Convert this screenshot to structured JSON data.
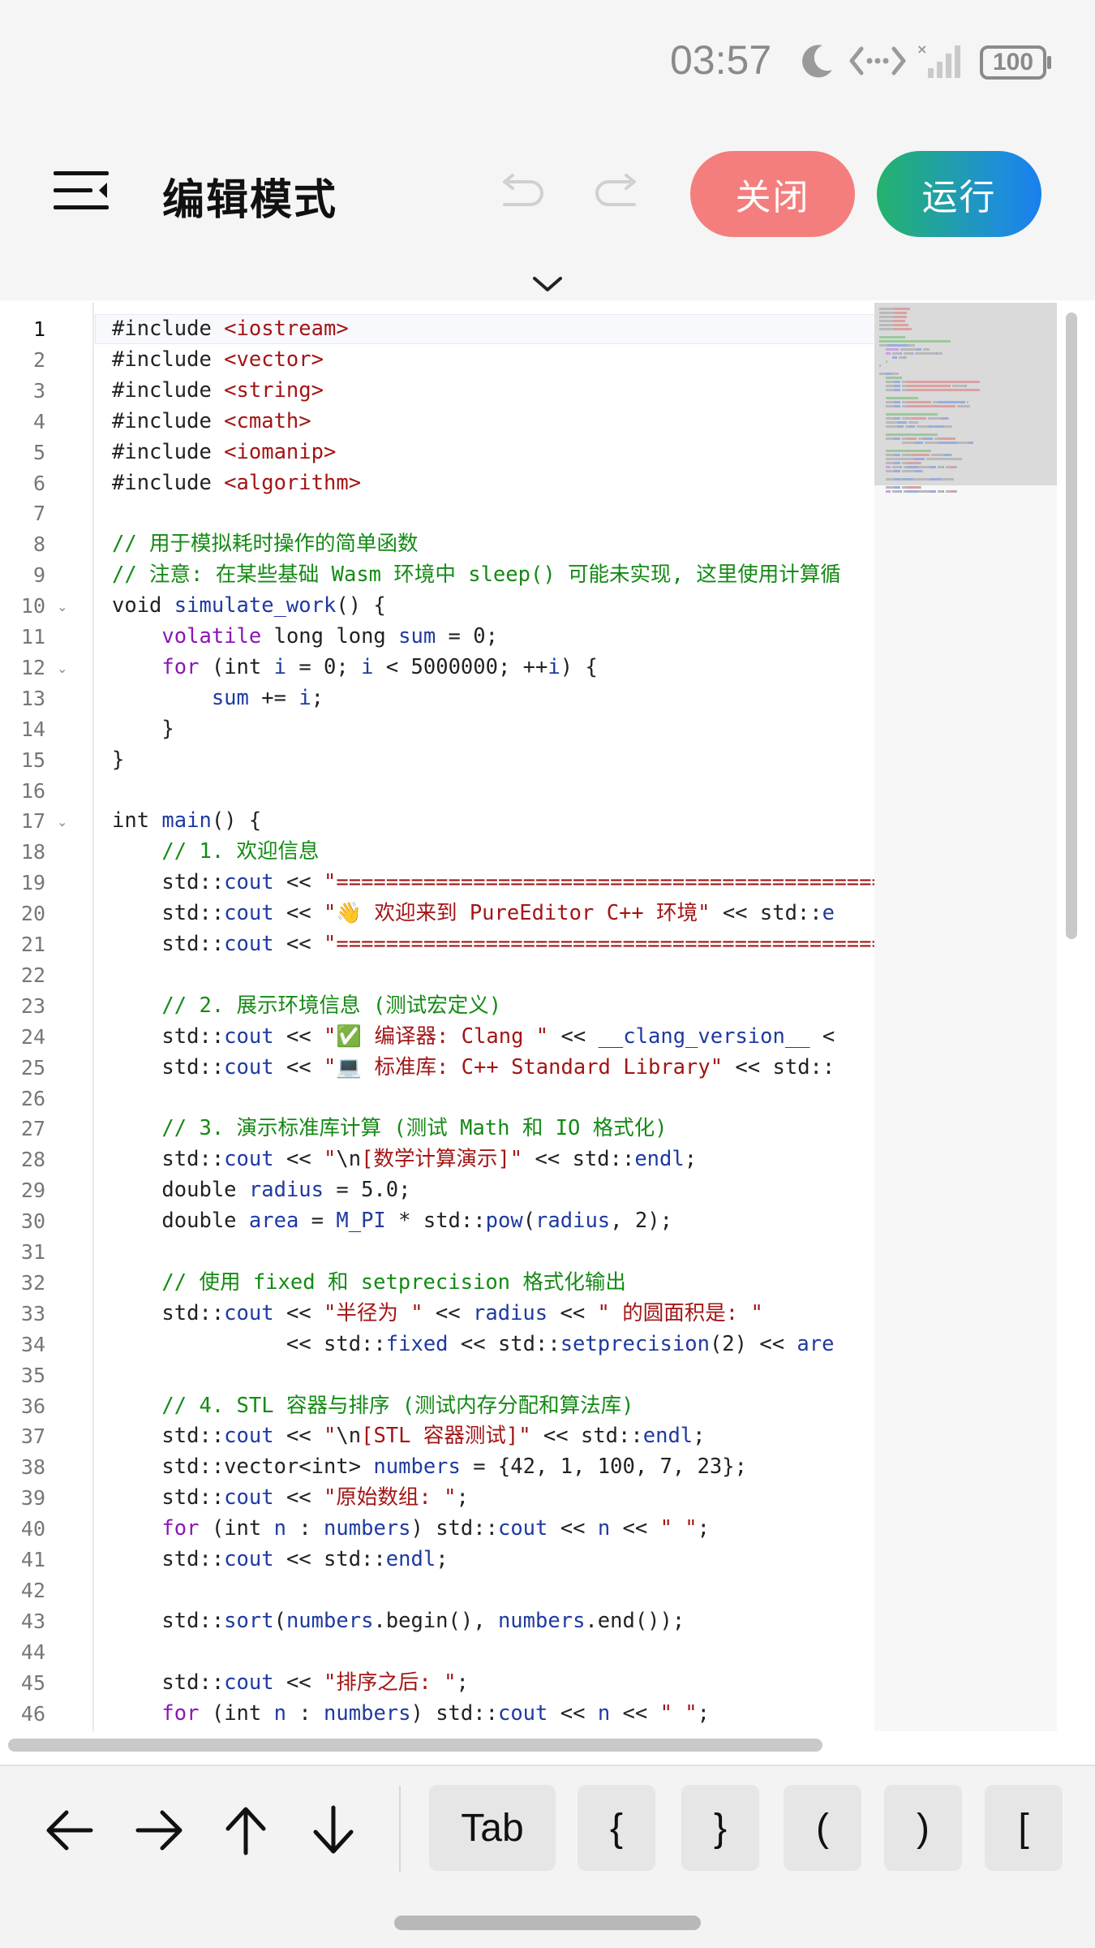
{
  "status_bar": {
    "time": "03:57",
    "battery": "100",
    "icons": [
      "moon-icon",
      "link-icon",
      "signal-icon",
      "battery-icon"
    ]
  },
  "header": {
    "title": "编辑模式",
    "close_label": "关闭",
    "run_label": "运行",
    "colors": {
      "close": "#f47e7e",
      "run_start": "#24b36b",
      "run_end": "#1a7fef"
    }
  },
  "editor": {
    "active_line": 1,
    "fold_lines": [
      10,
      12,
      17
    ],
    "lines": [
      [
        [
          "",
          "#include "
        ],
        [
          "str",
          "<iostream>"
        ]
      ],
      [
        [
          "",
          "#include "
        ],
        [
          "str",
          "<vector>"
        ]
      ],
      [
        [
          "",
          "#include "
        ],
        [
          "str",
          "<string>"
        ]
      ],
      [
        [
          "",
          "#include "
        ],
        [
          "str",
          "<cmath>"
        ]
      ],
      [
        [
          "",
          "#include "
        ],
        [
          "str",
          "<iomanip>"
        ]
      ],
      [
        [
          "",
          "#include "
        ],
        [
          "str",
          "<algorithm>"
        ]
      ],
      [],
      [
        [
          "cmt",
          "// 用于模拟耗时操作的简单函数"
        ]
      ],
      [
        [
          "cmt",
          "// 注意: 在某些基础 Wasm 环境中 sleep() 可能未实现, 这里使用计算循"
        ]
      ],
      [
        [
          "",
          "void "
        ],
        [
          "fn",
          "simulate_work"
        ],
        [
          "",
          "() {"
        ]
      ],
      [
        [
          "",
          "    "
        ],
        [
          "kw",
          "volatile"
        ],
        [
          "",
          " long long "
        ],
        [
          "fn",
          "sum"
        ],
        [
          "",
          " = 0;"
        ]
      ],
      [
        [
          "",
          "    "
        ],
        [
          "kw",
          "for"
        ],
        [
          "",
          " (int "
        ],
        [
          "fn",
          "i"
        ],
        [
          "",
          " = 0; "
        ],
        [
          "fn",
          "i"
        ],
        [
          "",
          " < 5000000; ++"
        ],
        [
          "fn",
          "i"
        ],
        [
          "",
          ") {"
        ]
      ],
      [
        [
          "",
          "        "
        ],
        [
          "fn",
          "sum"
        ],
        [
          "",
          " += "
        ],
        [
          "fn",
          "i"
        ],
        [
          "",
          ";"
        ]
      ],
      [
        [
          "",
          "    }"
        ]
      ],
      [
        [
          "",
          "}"
        ]
      ],
      [],
      [
        [
          "",
          "int "
        ],
        [
          "fn",
          "main"
        ],
        [
          "",
          "() {"
        ]
      ],
      [
        [
          "",
          "    "
        ],
        [
          "cmt",
          "// 1. 欢迎信息"
        ]
      ],
      [
        [
          "",
          "    std::"
        ],
        [
          "fn",
          "cout"
        ],
        [
          "",
          " << "
        ],
        [
          "str",
          "\"============================================"
        ]
      ],
      [
        [
          "",
          "    std::"
        ],
        [
          "fn",
          "cout"
        ],
        [
          "",
          " << "
        ],
        [
          "str",
          "\"👋 欢迎来到 PureEditor C++ 环境\""
        ],
        [
          "",
          " << std::"
        ],
        [
          "fn",
          "e"
        ]
      ],
      [
        [
          "",
          "    std::"
        ],
        [
          "fn",
          "cout"
        ],
        [
          "",
          " << "
        ],
        [
          "str",
          "\"============================================"
        ]
      ],
      [],
      [
        [
          "",
          "    "
        ],
        [
          "cmt",
          "// 2. 展示环境信息 (测试宏定义)"
        ]
      ],
      [
        [
          "",
          "    std::"
        ],
        [
          "fn",
          "cout"
        ],
        [
          "",
          " << "
        ],
        [
          "str",
          "\"✅ 编译器: Clang \""
        ],
        [
          "",
          " << "
        ],
        [
          "fn",
          "__clang_version__"
        ],
        [
          "",
          " <"
        ]
      ],
      [
        [
          "",
          "    std::"
        ],
        [
          "fn",
          "cout"
        ],
        [
          "",
          " << "
        ],
        [
          "str",
          "\"💻 标准库: C++ Standard Library\""
        ],
        [
          "",
          " << std::"
        ]
      ],
      [],
      [
        [
          "",
          "    "
        ],
        [
          "cmt",
          "// 3. 演示标准库计算 (测试 Math 和 IO 格式化)"
        ]
      ],
      [
        [
          "",
          "    std::"
        ],
        [
          "fn",
          "cout"
        ],
        [
          "",
          " << "
        ],
        [
          "str",
          "\""
        ],
        [
          "",
          "\\n"
        ],
        [
          "str",
          "[数学计算演示]\""
        ],
        [
          "",
          " << std::"
        ],
        [
          "fn",
          "endl"
        ],
        [
          "",
          ";"
        ]
      ],
      [
        [
          "",
          "    double "
        ],
        [
          "fn",
          "radius"
        ],
        [
          "",
          " = 5.0;"
        ]
      ],
      [
        [
          "",
          "    double "
        ],
        [
          "fn",
          "area"
        ],
        [
          "",
          " = "
        ],
        [
          "fn",
          "M_PI"
        ],
        [
          "",
          " * std::"
        ],
        [
          "fn",
          "pow"
        ],
        [
          "",
          "("
        ],
        [
          "fn",
          "radius"
        ],
        [
          "",
          ", 2);"
        ]
      ],
      [],
      [
        [
          "",
          "    "
        ],
        [
          "cmt",
          "// 使用 fixed 和 setprecision 格式化输出"
        ]
      ],
      [
        [
          "",
          "    std::"
        ],
        [
          "fn",
          "cout"
        ],
        [
          "",
          " << "
        ],
        [
          "str",
          "\"半径为 \""
        ],
        [
          "",
          " << "
        ],
        [
          "fn",
          "radius"
        ],
        [
          "",
          " << "
        ],
        [
          "str",
          "\" 的圆面积是: \""
        ]
      ],
      [
        [
          "",
          "              << std::"
        ],
        [
          "fn",
          "fixed"
        ],
        [
          "",
          " << std::"
        ],
        [
          "fn",
          "setprecision"
        ],
        [
          "",
          "(2) << "
        ],
        [
          "fn",
          "are"
        ]
      ],
      [],
      [
        [
          "",
          "    "
        ],
        [
          "cmt",
          "// 4. STL 容器与排序 (测试内存分配和算法库)"
        ]
      ],
      [
        [
          "",
          "    std::"
        ],
        [
          "fn",
          "cout"
        ],
        [
          "",
          " << "
        ],
        [
          "str",
          "\""
        ],
        [
          "",
          "\\n"
        ],
        [
          "str",
          "[STL 容器测试]\""
        ],
        [
          "",
          " << std::"
        ],
        [
          "fn",
          "endl"
        ],
        [
          "",
          ";"
        ]
      ],
      [
        [
          "",
          "    std::vector<int> "
        ],
        [
          "fn",
          "numbers"
        ],
        [
          "",
          " = {42, 1, 100, 7, 23};"
        ]
      ],
      [
        [
          "",
          "    std::"
        ],
        [
          "fn",
          "cout"
        ],
        [
          "",
          " << "
        ],
        [
          "str",
          "\"原始数组: \""
        ],
        [
          "",
          ";"
        ]
      ],
      [
        [
          "",
          "    "
        ],
        [
          "kw",
          "for"
        ],
        [
          "",
          " (int "
        ],
        [
          "fn",
          "n"
        ],
        [
          "",
          " : "
        ],
        [
          "fn",
          "numbers"
        ],
        [
          "",
          ") std::"
        ],
        [
          "fn",
          "cout"
        ],
        [
          "",
          " << "
        ],
        [
          "fn",
          "n"
        ],
        [
          "",
          " << "
        ],
        [
          "str",
          "\" \""
        ],
        [
          "",
          ";"
        ]
      ],
      [
        [
          "",
          "    std::"
        ],
        [
          "fn",
          "cout"
        ],
        [
          "",
          " << std::"
        ],
        [
          "fn",
          "endl"
        ],
        [
          "",
          ";"
        ]
      ],
      [],
      [
        [
          "",
          "    std::"
        ],
        [
          "fn",
          "sort"
        ],
        [
          "",
          "("
        ],
        [
          "fn",
          "numbers"
        ],
        [
          "",
          ".begin(), "
        ],
        [
          "fn",
          "numbers"
        ],
        [
          "",
          ".end());"
        ]
      ],
      [],
      [
        [
          "",
          "    std::"
        ],
        [
          "fn",
          "cout"
        ],
        [
          "",
          " << "
        ],
        [
          "str",
          "\"排序之后: \""
        ],
        [
          "",
          ";"
        ]
      ],
      [
        [
          "",
          "    "
        ],
        [
          "kw",
          "for"
        ],
        [
          "",
          " (int "
        ],
        [
          "fn",
          "n"
        ],
        [
          "",
          " : "
        ],
        [
          "fn",
          "numbers"
        ],
        [
          "",
          ") std::"
        ],
        [
          "fn",
          "cout"
        ],
        [
          "",
          " << "
        ],
        [
          "fn",
          "n"
        ],
        [
          "",
          " << "
        ],
        [
          "str",
          "\" \""
        ],
        [
          "",
          ";"
        ]
      ]
    ]
  },
  "toolbar": {
    "arrows": [
      "left-arrow-icon",
      "right-arrow-icon",
      "up-arrow-icon",
      "down-arrow-icon"
    ],
    "keys": [
      "Tab",
      "{",
      "}",
      "(",
      ")",
      "["
    ]
  }
}
